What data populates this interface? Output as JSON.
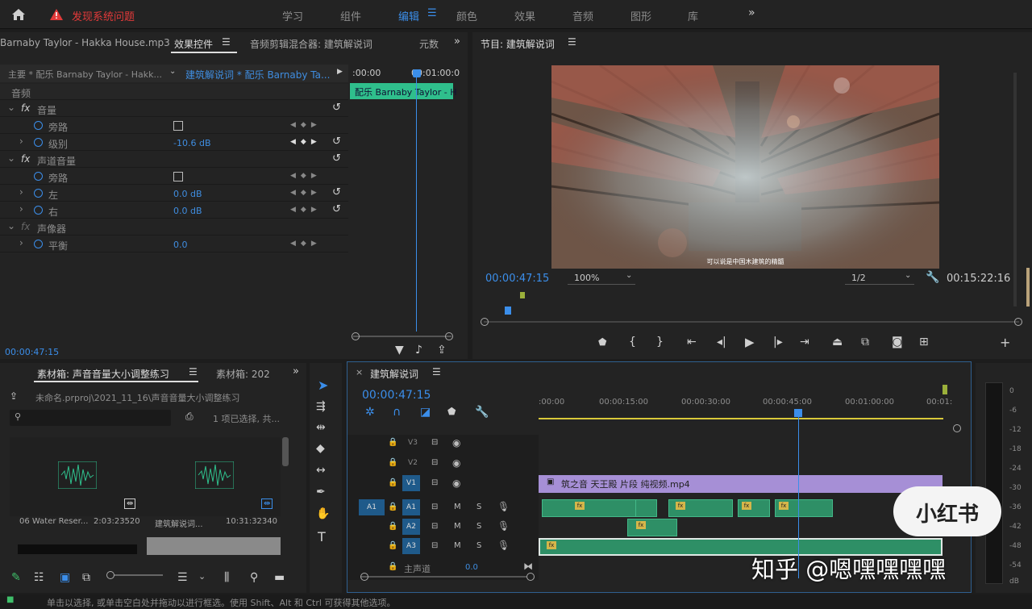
{
  "topbar": {
    "home_icon": "home-icon",
    "warning_text": "发现系统问题",
    "workspaces": [
      "学习",
      "组件",
      "编辑",
      "颜色",
      "效果",
      "音频",
      "图形",
      "库"
    ],
    "active_ws": "编辑",
    "more": "»"
  },
  "effects_panel": {
    "tab_left": "Barnaby Taylor - Hakka House.mp3",
    "tab_effects": "效果控件",
    "tab_mixer": "音频剪辑混合器: 建筑解说词",
    "tab_meta": "元数",
    "source_label": "主要 * 配乐 Barnaby Taylor - Hakk...",
    "seq_label": "建筑解说词 * 配乐 Barnaby Ta...",
    "time_start": ":00:00",
    "time_mid": "00:01:00:0",
    "clip_label": "配乐 Barnaby Taylor - H",
    "section": "音频",
    "rows": [
      {
        "name": "音量",
        "type": "fx"
      },
      {
        "name": "旁路",
        "type": "check"
      },
      {
        "name": "级别",
        "type": "value",
        "value": "-10.6 dB"
      },
      {
        "name": "声道音量",
        "type": "fx"
      },
      {
        "name": "旁路",
        "type": "check"
      },
      {
        "name": "左",
        "type": "value",
        "value": "0.0 dB"
      },
      {
        "name": "右",
        "type": "value",
        "value": "0.0 dB"
      },
      {
        "name": "声像器",
        "type": "fx"
      },
      {
        "name": "平衡",
        "type": "value",
        "value": "0.0"
      }
    ],
    "timecode": "00:00:47:15"
  },
  "program": {
    "title": "节目: 建筑解说词",
    "subtitle": "可以说是中国木建筑的精髓",
    "timecode": "00:00:47:15",
    "zoom": "100%",
    "quality": "1/2",
    "duration": "00:15:22:16"
  },
  "bin": {
    "tab": "素材箱: 声音音量大小调整练习",
    "tab2": "素材箱: 202",
    "path": "未命名.prproj\\2021_11_16\\声音音量大小调整练习",
    "selection": "1 项已选择, 共...",
    "items": [
      {
        "name": "06 Water Reser...",
        "dur": "2:03:23520"
      },
      {
        "name": "建筑解说词...",
        "dur": "10:31:32340"
      }
    ]
  },
  "timeline": {
    "title": "建筑解说词",
    "timecode": "00:00:47:15",
    "ruler": [
      ":00:00",
      "00:00:15:00",
      "00:00:30:00",
      "00:00:45:00",
      "00:01:00:00",
      "00:01:"
    ],
    "tracks": [
      {
        "id": "V3"
      },
      {
        "id": "V2"
      },
      {
        "id": "V1"
      },
      {
        "id": "A1",
        "src": "A1"
      },
      {
        "id": "A2"
      },
      {
        "id": "A3"
      }
    ],
    "master": "主声道",
    "master_val": "0.0",
    "video_clip": "筑之音 天王殿 片段 纯视频.mp4",
    "m": "M",
    "s": "S"
  },
  "meter_ticks": [
    "0",
    "-6",
    "-12",
    "-18",
    "-24",
    "-30",
    "-36",
    "-42",
    "-48",
    "-54",
    "dB"
  ],
  "watermark": {
    "badge": "小红书",
    "text": "知乎 @嗯嘿嘿嘿嘿"
  },
  "status": "单击以选择, 或单击空白处并拖动以进行框选。使用 Shift、Alt 和 Ctrl 可获得其他选项。",
  "colors": {
    "accent": "#3b8eea",
    "audio_clip": "#2e8f66",
    "video_clip": "#a68fd6",
    "warn": "#e23a3a"
  }
}
